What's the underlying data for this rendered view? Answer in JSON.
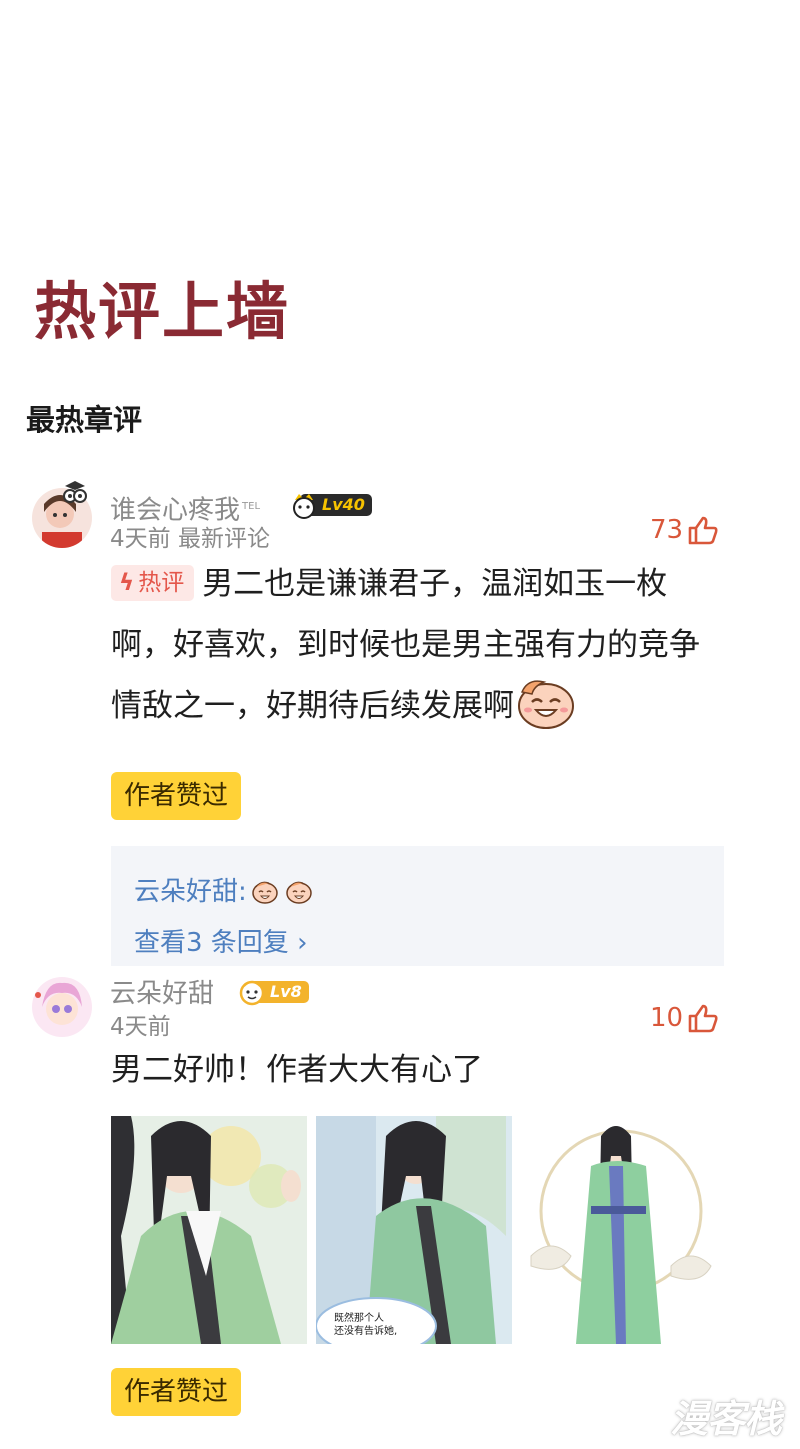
{
  "page_title": "热评上墙",
  "section_title": "最热章评",
  "comments": [
    {
      "username": "谁会心疼我",
      "username_suffix": "TEL",
      "level": "Lv40",
      "time": "4天前",
      "tag_latest": "最新评论",
      "likes": "73",
      "hot_tag": "热评",
      "text": "男二也是谦谦君子，温润如玉一枚啊，好喜欢，到时候也是男主强有力的竞争情敌之一，好期待后续发展啊",
      "author_badge": "作者赞过",
      "reply_preview_user": "云朵好甜:",
      "view_replies": "查看3 条回复",
      "emoji": "smile-face-icon"
    },
    {
      "username": "云朵好甜",
      "level": "Lv8",
      "time": "4天前",
      "likes": "10",
      "text": "男二好帅！作者大大有心了",
      "author_badge": "作者赞过",
      "panel_text": "既然那个人\n还没有告诉她,"
    }
  ],
  "watermark": "漫客栈",
  "colors": {
    "title": "#8a2a33",
    "likes": "#d9573a",
    "link": "#4e7fbf",
    "badge_bg": "#ffd237",
    "hot_tag_bg": "#fde8e6"
  }
}
